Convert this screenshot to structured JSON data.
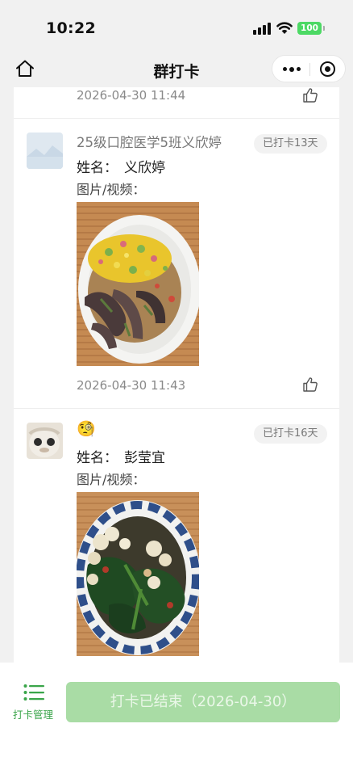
{
  "status_bar": {
    "time": "10:22",
    "battery": "100"
  },
  "nav": {
    "title": "群打卡"
  },
  "feed": {
    "field_labels": {
      "name": "姓名：",
      "media": "图片/视频："
    },
    "partial_entry": {
      "timestamp": "2026-04-30 11:44"
    },
    "entries": [
      {
        "nickname": "25级口腔医学5班义欣婷",
        "days_badge": "已打卡13天",
        "name_value": "义欣婷",
        "timestamp": "2026-04-30 11:43",
        "photo": "food-photo-eggplant-corn-rice"
      },
      {
        "nickname": "🧐",
        "days_badge": "已打卡16天",
        "name_value": "彭莹宜",
        "photo": "food-photo-cauliflower-greens"
      }
    ]
  },
  "bottom_bar": {
    "manage_label": "打卡管理",
    "checkin_button": "打卡已结束（2026-04-30）"
  },
  "colors": {
    "accent": "#3aa54a",
    "button_disabled": "#a9dca5",
    "badge_bg": "#f2f2f2"
  }
}
